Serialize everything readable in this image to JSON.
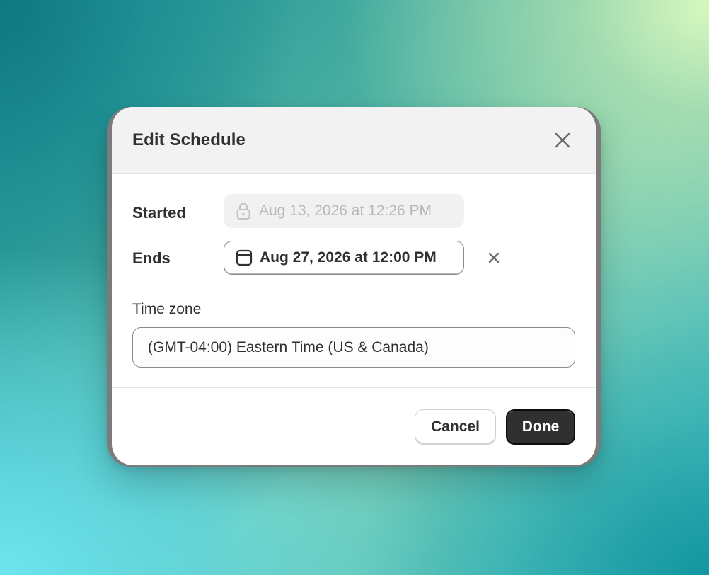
{
  "modal": {
    "title": "Edit Schedule",
    "close_icon": "close-icon"
  },
  "schedule": {
    "started_label": "Started",
    "started_value": "Aug 13, 2026 at 12:26 PM",
    "started_icon": "lock-icon",
    "ends_label": "Ends",
    "ends_value": "Aug 27, 2026 at 12:00 PM",
    "ends_icon": "calendar-icon",
    "clear_icon": "x-icon"
  },
  "timezone": {
    "label": "Time zone",
    "value": "(GMT-04:00) Eastern Time (US & Canada)"
  },
  "actions": {
    "cancel_label": "Cancel",
    "done_label": "Done"
  },
  "colors": {
    "primary_button": "#303030",
    "text": "#303030",
    "disabled_text": "#b7b7b7",
    "header_bg": "#f2f2f2"
  }
}
